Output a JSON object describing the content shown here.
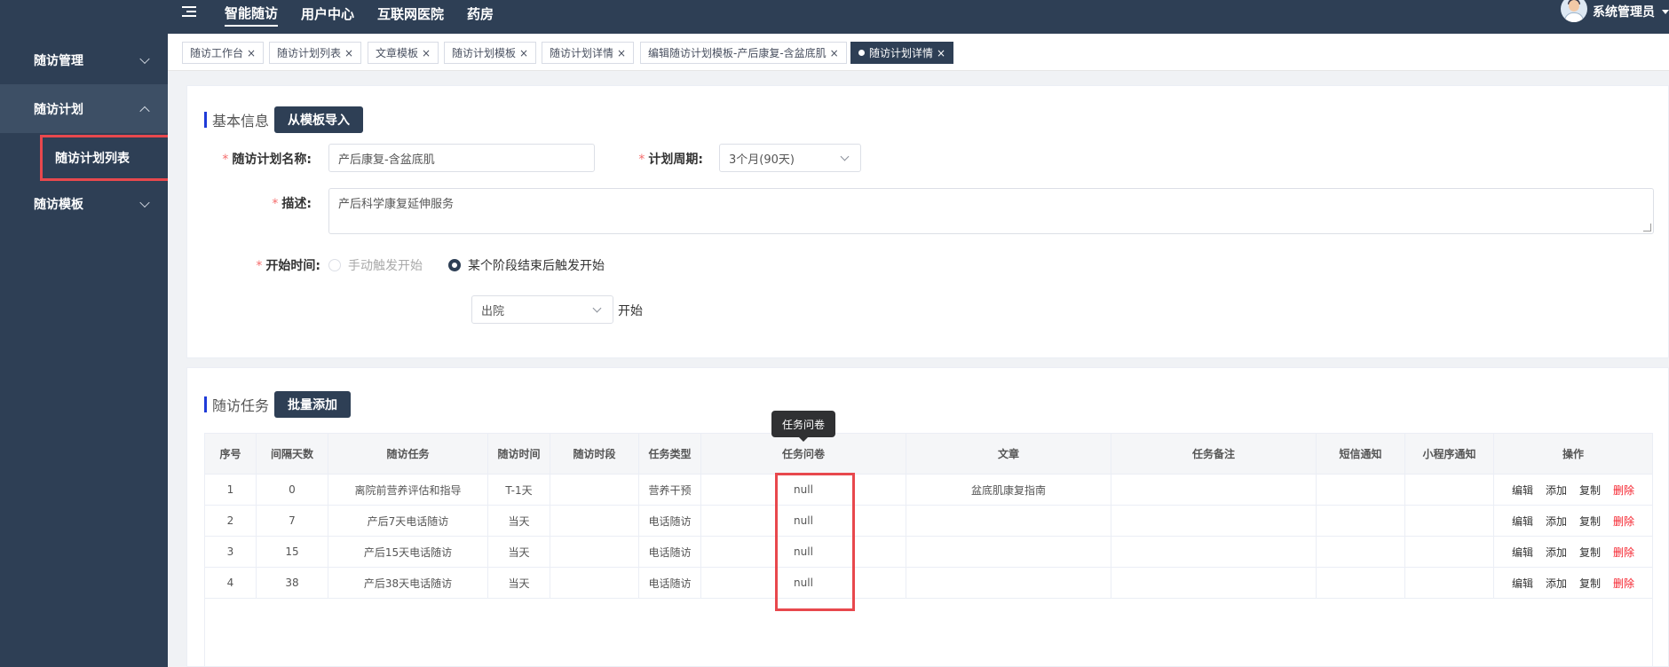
{
  "sidebar": {
    "items": [
      {
        "label": "随访管理"
      },
      {
        "label": "随访计划"
      },
      {
        "label": "随访模板"
      }
    ],
    "sub_item": {
      "label": "随访计划列表"
    }
  },
  "topbar": {
    "nav": [
      "智能随访",
      "用户中心",
      "互联网医院",
      "药房"
    ],
    "user_name": "系统管理员"
  },
  "tabs": [
    {
      "label": "随访工作台"
    },
    {
      "label": "随访计划列表"
    },
    {
      "label": "文章模板"
    },
    {
      "label": "随访计划模板"
    },
    {
      "label": "随访计划详情"
    },
    {
      "label": "编辑随访计划模板-产后康复-含盆底肌"
    },
    {
      "label": "随访计划详情"
    }
  ],
  "basic_info": {
    "title": "基本信息",
    "import_button": "从模板导入",
    "plan_name_label": "随访计划名称:",
    "plan_name_value": "产后康复-含盆底肌",
    "period_label": "计划周期:",
    "period_value": "3个月(90天)",
    "desc_label": "描述:",
    "desc_value": "产后科学康复延伸服务",
    "start_label": "开始时间:",
    "radio_manual": "手动触发开始",
    "radio_stage": "某个阶段结束后触发开始",
    "stage_value": "出院",
    "start_suffix": "开始"
  },
  "tasks": {
    "title": "随访任务",
    "batch_button": "批量添加",
    "tooltip": "任务问卷",
    "headers": [
      "序号",
      "间隔天数",
      "随访任务",
      "随访时间",
      "随访时段",
      "任务类型",
      "任务问卷",
      "文章",
      "任务备注",
      "短信通知",
      "小程序通知",
      "操作"
    ],
    "actions": {
      "edit": "编辑",
      "add": "添加",
      "copy": "复制",
      "delete": "删除"
    },
    "rows": [
      {
        "no": "1",
        "interval": "0",
        "task": "离院前营养评估和指导",
        "time": "T-1天",
        "period": "",
        "type": "营养干预",
        "questionnaire": "null",
        "article": "盆底肌康复指南",
        "remark": "",
        "sms": "",
        "mini": ""
      },
      {
        "no": "2",
        "interval": "7",
        "task": "产后7天电话随访",
        "time": "当天",
        "period": "",
        "type": "电话随访",
        "questionnaire": "null",
        "article": "",
        "remark": "",
        "sms": "",
        "mini": ""
      },
      {
        "no": "3",
        "interval": "15",
        "task": "产后15天电话随访",
        "time": "当天",
        "period": "",
        "type": "电话随访",
        "questionnaire": "null",
        "article": "",
        "remark": "",
        "sms": "",
        "mini": ""
      },
      {
        "no": "4",
        "interval": "38",
        "task": "产后38天电话随访",
        "time": "当天",
        "period": "",
        "type": "电话随访",
        "questionnaire": "null",
        "article": "",
        "remark": "",
        "sms": "",
        "mini": ""
      }
    ]
  }
}
